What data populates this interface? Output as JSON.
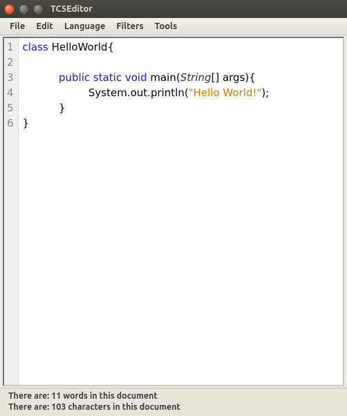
{
  "window": {
    "title": "TC5Editor"
  },
  "menubar": {
    "items": [
      "File",
      "Edit",
      "Language",
      "Filters",
      "Tools"
    ]
  },
  "editor": {
    "gutter_start": 1,
    "lines": [
      {
        "n": 1,
        "segments": [
          {
            "t": "class ",
            "cls": "kw"
          },
          {
            "t": "HelloWorld{",
            "cls": ""
          }
        ]
      },
      {
        "n": 2,
        "segments": [
          {
            "t": " ",
            "cls": ""
          }
        ]
      },
      {
        "n": 3,
        "segments": [
          {
            "t": "           ",
            "cls": ""
          },
          {
            "t": "public static void ",
            "cls": "kw"
          },
          {
            "t": "main(",
            "cls": ""
          },
          {
            "t": "String",
            "cls": "param-type"
          },
          {
            "t": "[] args){",
            "cls": ""
          }
        ]
      },
      {
        "n": 4,
        "segments": [
          {
            "t": "                    System.out.println(",
            "cls": ""
          },
          {
            "t": "\"Hello World!\"",
            "cls": "str"
          },
          {
            "t": ");",
            "cls": ""
          }
        ]
      },
      {
        "n": 5,
        "segments": [
          {
            "t": "           }",
            "cls": ""
          }
        ]
      },
      {
        "n": 6,
        "segments": [
          {
            "t": "}",
            "cls": ""
          }
        ]
      }
    ]
  },
  "statusbar": {
    "line1": "There are: 11 words in this document",
    "line2": "There are: 103 characters in this document"
  }
}
